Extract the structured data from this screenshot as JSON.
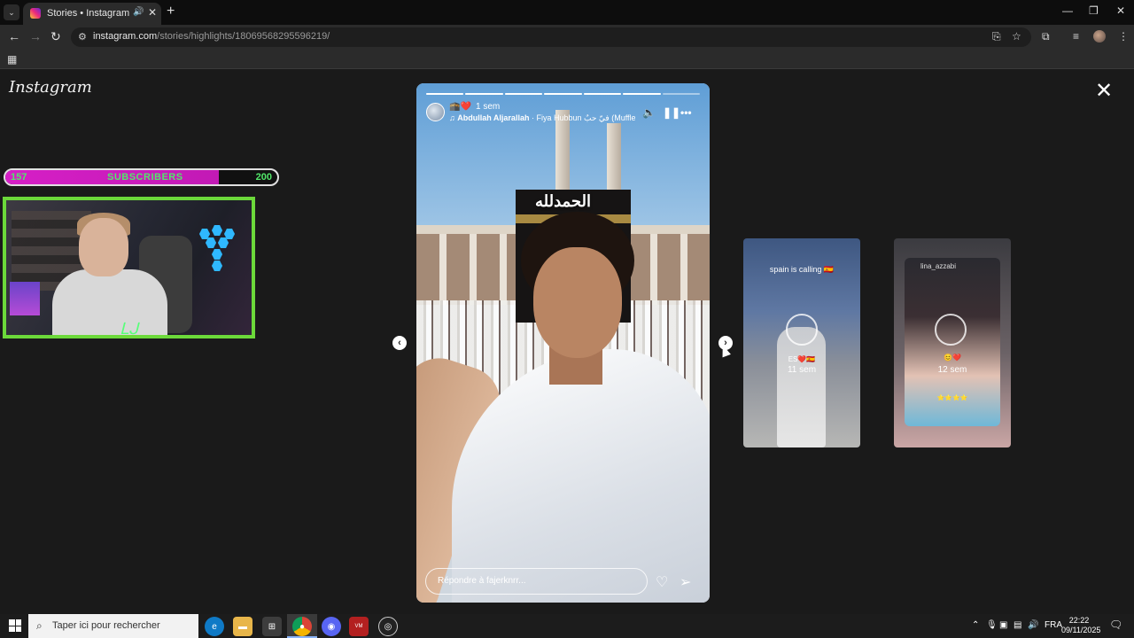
{
  "browser": {
    "tab_title": "Stories • Instagram",
    "url_domain": "instagram.com",
    "url_path": "/stories/highlights/18069568295596219/",
    "icons": [
      "tab-search-icon",
      "instagram-favicon",
      "audio-icon",
      "close-icon",
      "plus-icon",
      "minimize-icon",
      "restore-icon",
      "close-window-icon",
      "back-icon",
      "forward-icon",
      "reload-icon",
      "site-settings-icon",
      "install-icon",
      "star-icon",
      "extensions-icon",
      "media-icon",
      "profile-avatar",
      "kebab-menu-icon",
      "apps-grid-icon"
    ]
  },
  "page": {
    "logo": "Instagram",
    "close_label": "✕"
  },
  "overlay": {
    "subscribers_current": "157",
    "subscribers_label": "SUBSCRIBERS",
    "subscribers_goal": "200",
    "subscribers_progress": 0.785,
    "signature": "ᒪᒍ"
  },
  "story": {
    "progress_segments": 7,
    "progress_done": 6,
    "emojis": "🕋❤️",
    "time": "1 sem",
    "music_artist": "Abdullah Aljarallah",
    "music_title": " · Fiya Hubbun ‏فيّ حبٌ (Muffled) (feat",
    "arabic_text": "الحمدلله",
    "reply_placeholder": "Répondre à fajerknrr...",
    "colors": {
      "accent": "#ffffff"
    }
  },
  "previews": [
    {
      "caption": "spain is calling 🇪🇸",
      "sub": "ES❤️🇪🇸",
      "time": "11 sem"
    },
    {
      "name": "lina_azzabi",
      "sub": "😊❤️",
      "time": "12 sem",
      "stars": "⭐⭐⭐⭐"
    }
  ],
  "taskbar": {
    "search_placeholder": "Taper ici pour rechercher",
    "language": "FRA",
    "time": "22:22",
    "date": "09/11/2025",
    "apps": [
      "edge-icon",
      "file-explorer-icon",
      "store-icon",
      "chrome-icon",
      "discord-icon",
      "voicemeeter-icon",
      "obs-icon"
    ]
  }
}
